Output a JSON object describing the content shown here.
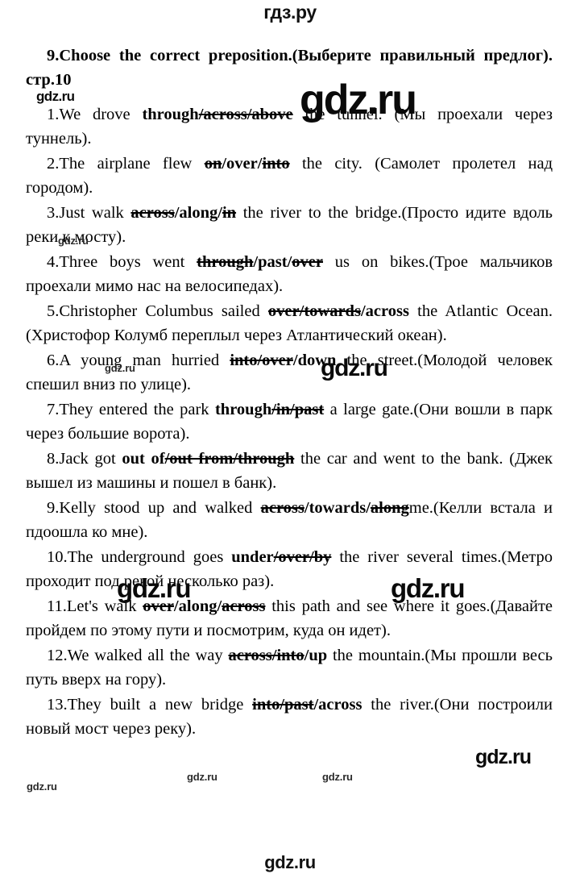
{
  "header": {
    "logo": "гдз.ру"
  },
  "footer": {
    "logo": "gdz.ru"
  },
  "task": {
    "number": "9.",
    "prompt_en": "Choose the correct preposition.",
    "prompt_ru": "(Выберите правильный предлог).",
    "page_ref": "стр.10"
  },
  "questions": [
    {
      "num": "1.",
      "pre": "We drove ",
      "bold": "through",
      "strike": "/across/above",
      "post": " the tunnel. ",
      "translation": "(Мы проехали через туннель)."
    },
    {
      "num": "2.",
      "pre": "The airplane flew ",
      "strike1": "on",
      "bold": "/over/",
      "strike2": "into",
      "post": " the city. ",
      "translation": "(Самолет пролетел над городом)."
    },
    {
      "num": "3.",
      "pre": "Just walk ",
      "strike1": "across",
      "bold": "/along/",
      "strike2": "in",
      "post": " the river to the bridge.",
      "translation": "(Просто идите вдоль реки к мосту)."
    },
    {
      "num": "4.",
      "pre": "Three boys went ",
      "strike1": "through",
      "bold": "/past/",
      "strike2": "over",
      "post": " us on bikes.",
      "translation": "(Трое мальчиков проехали мимо нас на велосипедах)."
    },
    {
      "num": "5.",
      "pre": "Christopher Columbus sailed ",
      "strike": "over/towards",
      "bold": "/across",
      "post": " the Atlantic Ocean. ",
      "translation": "(Христофор Колумб переплыл через Атлантический океан)."
    },
    {
      "num": "6.",
      "pre": "A young man hurried ",
      "strike": "into/over",
      "bold": "/down",
      "post": " the street.",
      "translation": "(Молодой человек спешил вниз по улице)."
    },
    {
      "num": "7.",
      "pre": "They entered the park ",
      "bold": "through",
      "strike": "/in/past",
      "post": " a large gate.",
      "translation": "(Они вошли в парк через большие ворота)."
    },
    {
      "num": "8.",
      "pre": "Jack got ",
      "bold": "out of",
      "strike": "/out from/through",
      "post": " the car and went to the bank. ",
      "translation": "(Джек вышел из машины и пошел в банк)."
    },
    {
      "num": "9.",
      "pre": "Kelly stood up and walked ",
      "strike1": "across",
      "bold": "/towards/",
      "strike2": "along",
      "post": "me.",
      "translation": "(Келли встала и пдоошла ко мне)."
    },
    {
      "num": "10.",
      "pre": "The underground goes ",
      "bold": "under",
      "strike": "/over/by",
      "post": " the river several times.",
      "translation": "(Метро проходит под рекой несколько раз)."
    },
    {
      "num": "11.",
      "pre": "Let's walk ",
      "strike1": "over",
      "bold": "/along/",
      "strike2": "across",
      "post": " this path and see where it goes.",
      "translation": "(Давайте пройдем по этому пути и посмотрим, куда он идет)."
    },
    {
      "num": "12.",
      "pre": "We walked all the way ",
      "strike": "across/into",
      "bold": "/up",
      "post": " the mountain.",
      "translation": "(Мы прошли весь путь вверх на гору)."
    },
    {
      "num": "13.",
      "pre": "They built a new bridge ",
      "strike": "into/past",
      "bold": "/across",
      "post": " the river.",
      "translation": "(Они построили новый мост через реку)."
    }
  ],
  "watermarks": {
    "text": "gdz.ru",
    "items": [
      "gdz.ru",
      "gdz.ru",
      "gdz.ru",
      "gdz.ru",
      "gdz.ru",
      "gdz.ru",
      "gdz.ru",
      "gdz.ru",
      "gdz.ru",
      "gdz.ru",
      "gdz.ru"
    ]
  }
}
